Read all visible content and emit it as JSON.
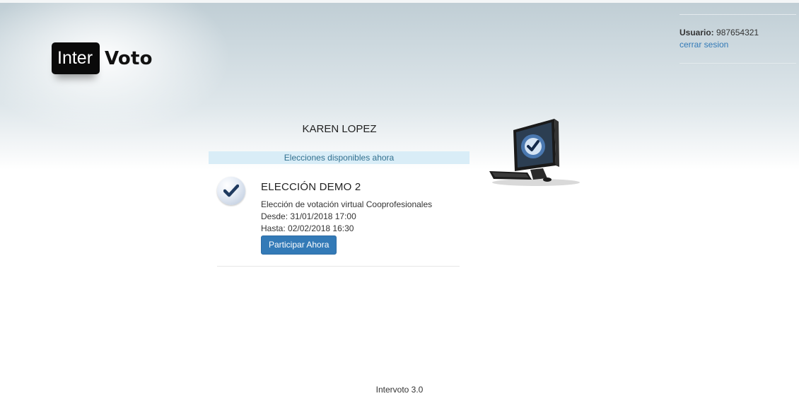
{
  "header": {
    "logo_left": "Inter",
    "logo_right": "Voto"
  },
  "user": {
    "label": "Usuario:",
    "id": "987654321",
    "logout_label": "cerrar sesion"
  },
  "voter_name": "KAREN LOPEZ",
  "banner": "Elecciones disponibles ahora",
  "elections": [
    {
      "title": "ELECCIÓN DEMO 2",
      "description": "Elección de votación virtual Cooprofesionales",
      "from": "Desde: 31/01/2018 17:00",
      "to": "Hasta: 02/02/2018 16:30",
      "button_label": "Participar Ahora",
      "icon": "checkmark-icon"
    }
  ],
  "footer": "Intervoto 3.0",
  "colors": {
    "accent": "#337ab7",
    "banner_bg": "#d9edf7",
    "banner_text": "#31708f"
  }
}
